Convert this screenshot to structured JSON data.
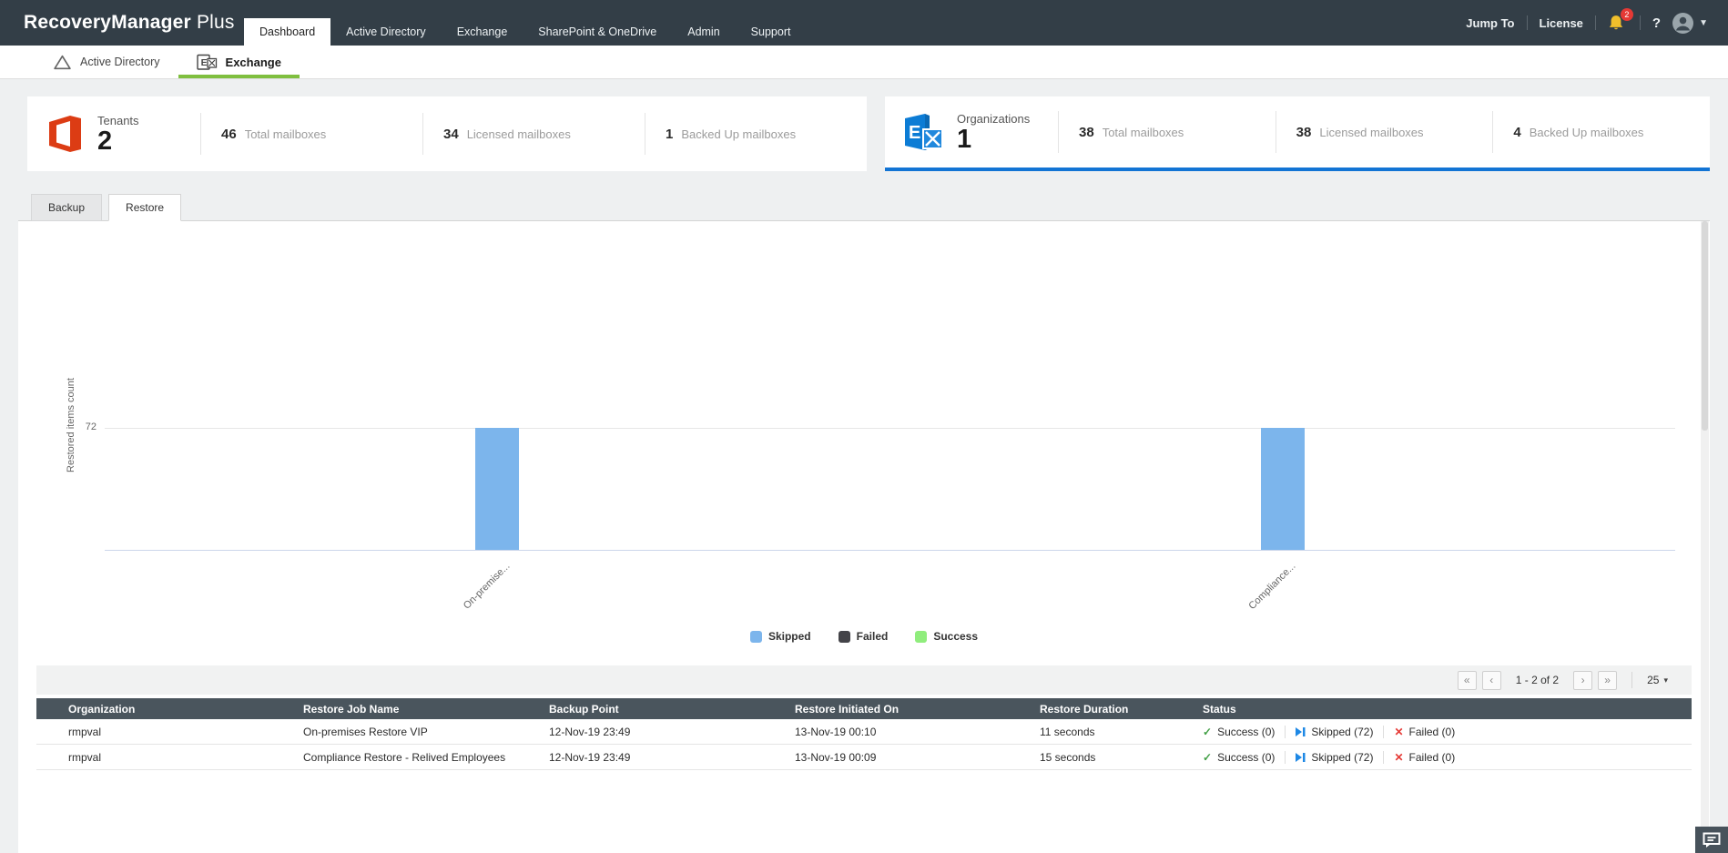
{
  "brand": {
    "name": "RecoveryManager",
    "suffix": "Plus"
  },
  "topnav": {
    "tabs": [
      {
        "label": "Dashboard",
        "active": true
      },
      {
        "label": "Active Directory",
        "active": false
      },
      {
        "label": "Exchange",
        "active": false
      },
      {
        "label": "SharePoint & OneDrive",
        "active": false
      },
      {
        "label": "Admin",
        "active": false
      },
      {
        "label": "Support",
        "active": false
      }
    ],
    "jump_to": "Jump To",
    "license": "License",
    "notification_count": "2",
    "help": "?"
  },
  "subtabs": [
    {
      "label": "Active Directory",
      "active": false
    },
    {
      "label": "Exchange",
      "active": true
    }
  ],
  "summary_cards": [
    {
      "title": "Tenants",
      "count": "2",
      "stats": [
        {
          "value": "46",
          "label": "Total mailboxes"
        },
        {
          "value": "34",
          "label": "Licensed mailboxes"
        },
        {
          "value": "1",
          "label": "Backed Up mailboxes"
        }
      ]
    },
    {
      "title": "Organizations",
      "count": "1",
      "selected": true,
      "stats": [
        {
          "value": "38",
          "label": "Total mailboxes"
        },
        {
          "value": "38",
          "label": "Licensed mailboxes"
        },
        {
          "value": "4",
          "label": "Backed Up mailboxes"
        }
      ]
    }
  ],
  "panel_tabs": [
    {
      "label": "Backup",
      "active": false
    },
    {
      "label": "Restore",
      "active": true
    }
  ],
  "chart_data": {
    "type": "bar",
    "title": "",
    "categories": [
      "On-premise...",
      "Compliance..."
    ],
    "series": [
      {
        "name": "Skipped",
        "values": [
          72,
          72
        ],
        "color": "#7cb5ec"
      },
      {
        "name": "Failed",
        "values": [
          0,
          0
        ],
        "color": "#434348"
      },
      {
        "name": "Success",
        "values": [
          0,
          0
        ],
        "color": "#90ed7d"
      }
    ],
    "xlabel": "",
    "ylabel": "Restored items count",
    "yticks": [
      72
    ],
    "ylim": [
      0,
      190
    ],
    "grid": true,
    "legend_position": "bottom"
  },
  "pagination": {
    "first": "«",
    "prev": "‹",
    "range": "1 - 2 of 2",
    "next": "›",
    "last": "»",
    "page_size": "25",
    "size_caret": "▾"
  },
  "table": {
    "columns": [
      "Organization",
      "Restore Job Name",
      "Backup Point",
      "Restore Initiated On",
      "Restore Duration",
      "Status"
    ],
    "rows": [
      {
        "organization": "rmpval",
        "job": "On-premises Restore VIP",
        "backup_point": "12-Nov-19 23:49",
        "initiated": "13-Nov-19 00:10",
        "duration": "11 seconds",
        "success": "Success (0)",
        "skipped": "Skipped (72)",
        "failed": "Failed (0)"
      },
      {
        "organization": "rmpval",
        "job": "Compliance Restore - Relived Employees",
        "backup_point": "12-Nov-19 23:49",
        "initiated": "13-Nov-19 00:09",
        "duration": "15 seconds",
        "success": "Success (0)",
        "skipped": "Skipped (72)",
        "failed": "Failed (0)"
      }
    ],
    "status_icons": {
      "success": "✓",
      "failed": "✕"
    }
  },
  "colors": {
    "navbar": "#333e47",
    "active_subtab_underline": "#7fbf3f",
    "selected_card_border": "#1274d4",
    "table_header": "#4a555d",
    "success": "#43a047",
    "failed": "#e53935",
    "skipped": "#1e88e5"
  }
}
